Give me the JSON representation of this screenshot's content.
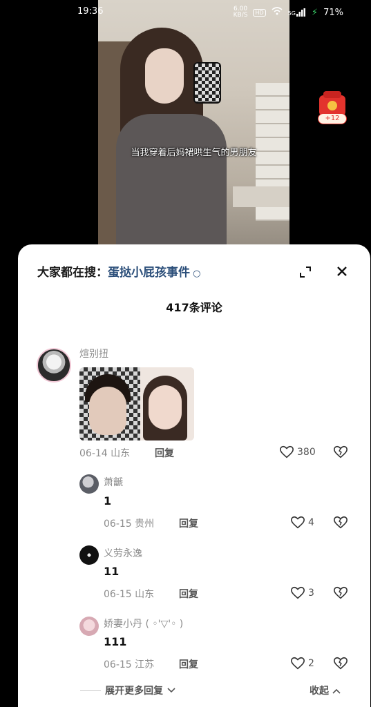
{
  "status": {
    "time": "19:36",
    "speed": "6.00",
    "speed_unit": "KB/S",
    "hd": "HD",
    "signal": "5G",
    "battery": "71%"
  },
  "video": {
    "subtitle": "当我穿着后妈裙哄生气的男朋友"
  },
  "redpacket": {
    "badge": "+12"
  },
  "sheet": {
    "search_prefix": "大家都在搜：",
    "search_query": "蛋挞小屁孩事件",
    "comment_count": "417条评论",
    "reply_label": "回复",
    "more_replies": "展开更多回复",
    "collapse": "收起"
  },
  "comments": [
    {
      "user": "煊别扭",
      "date": "06-14",
      "location": "山东",
      "likes": "380"
    }
  ],
  "replies": [
    {
      "user": "萧䶵",
      "text": "1",
      "date": "06-15",
      "location": "贵州",
      "likes": "4"
    },
    {
      "user": "义劳永逸",
      "text": "11",
      "date": "06-15",
      "location": "山东",
      "likes": "3"
    },
    {
      "user": "娇妻小丹 ( ◦'▽'◦ )",
      "text": "111",
      "date": "06-15",
      "location": "江苏",
      "likes": "2"
    }
  ],
  "icons": {
    "expand": "expand-icon",
    "close": "close-icon",
    "heart": "heart-icon",
    "dislike": "broken-heart-icon",
    "search": "search-icon"
  }
}
